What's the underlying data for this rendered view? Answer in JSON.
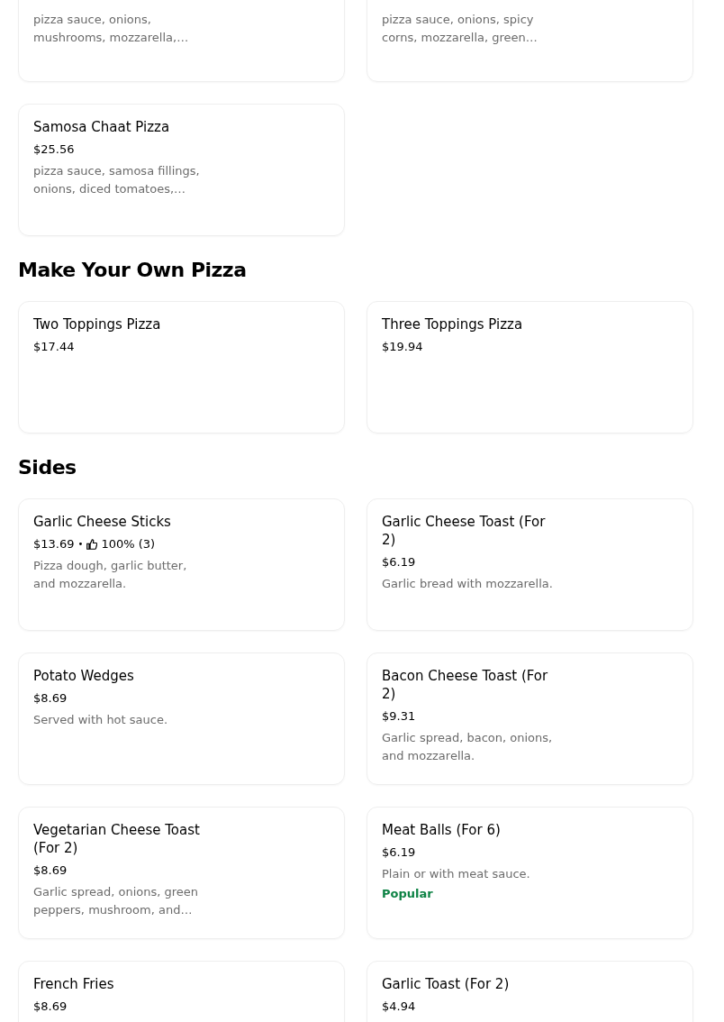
{
  "sections": [
    {
      "items": [
        {
          "description": "pizza sauce, onions, mushrooms, mozzarella,…"
        },
        {
          "description": "pizza sauce, onions, spicy corns, mozzarella, green…"
        },
        {
          "name": "Samosa Chaat Pizza",
          "price": "$25.56",
          "description": "pizza sauce, samosa fillings, onions, diced tomatoes,…"
        }
      ]
    },
    {
      "title": "Make Your Own Pizza",
      "items": [
        {
          "name": "Two Toppings Pizza",
          "price": "$17.44"
        },
        {
          "name": "Three Toppings Pizza",
          "price": "$19.94"
        }
      ]
    },
    {
      "title": "Sides",
      "items": [
        {
          "name": "Garlic Cheese Sticks",
          "price": "$13.69",
          "separator": "•",
          "rating": "100% (3)",
          "description": "Pizza dough, garlic butter, and mozzarella."
        },
        {
          "name": "Garlic Cheese Toast (For 2)",
          "price": "$6.19",
          "description": "Garlic bread with mozzarella."
        },
        {
          "name": "Potato Wedges",
          "price": "$8.69",
          "description": "Served with hot sauce."
        },
        {
          "name": "Bacon Cheese Toast (For 2)",
          "price": "$9.31",
          "description": "Garlic spread, bacon, onions, and mozzarella."
        },
        {
          "name": "Vegetarian Cheese Toast (For 2)",
          "price": "$8.69",
          "description": "Garlic spread, onions, green peppers, mushroom, and…"
        },
        {
          "name": "Meat Balls (For 6)",
          "price": "$6.19",
          "description": "Plain or with meat sauce.",
          "tag": "Popular"
        },
        {
          "name": "French Fries",
          "price": "$8.69"
        },
        {
          "name": "Garlic Toast (For 2)",
          "price": "$4.94"
        }
      ]
    }
  ]
}
